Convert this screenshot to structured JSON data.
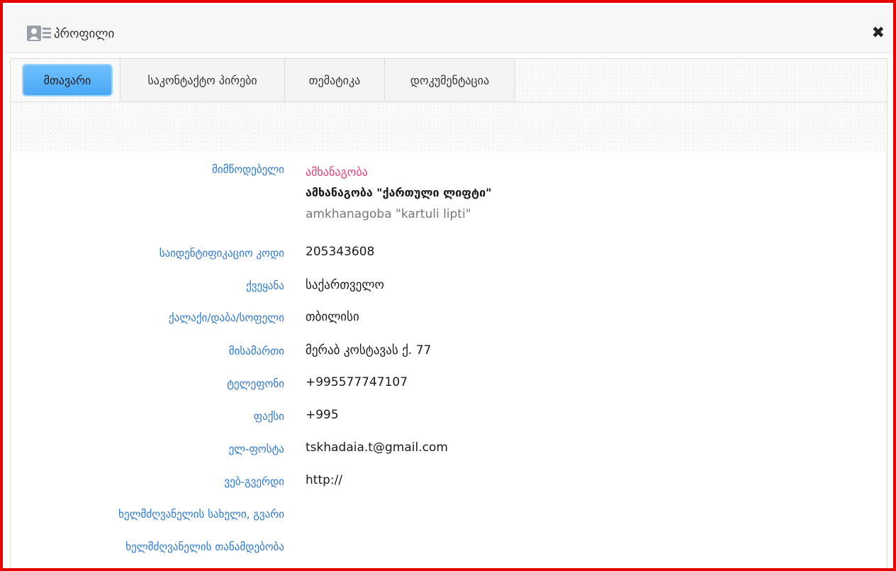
{
  "window": {
    "title": "პროფილი",
    "close_symbol": "✖"
  },
  "tabs": [
    {
      "label": "მთავარი",
      "active": true
    },
    {
      "label": "საკონტაქტო პირები",
      "active": false
    },
    {
      "label": "თემატიკა",
      "active": false
    },
    {
      "label": "დოკუმენტაცია",
      "active": false
    }
  ],
  "fields": {
    "supplier": {
      "label": "მიმწოდებელი",
      "type": "ამხანაგობა",
      "name_ka": "ამხანაგობა \"ქართული ლიფტი\"",
      "name_en": "amkhanagoba \"kartuli lipti\""
    },
    "id_code": {
      "label": "საიდენტიფიკაციო კოდი",
      "value": "205343608"
    },
    "country": {
      "label": "ქვეყანა",
      "value": "საქართველო"
    },
    "city": {
      "label": "ქალაქი/დაბა/სოფელი",
      "value": "თბილისი"
    },
    "address": {
      "label": "მისამართი",
      "value": "მერაბ კოსტავას ქ. 77"
    },
    "phone": {
      "label": "ტელეფონი",
      "value": "+995577747107"
    },
    "fax": {
      "label": "ფაქსი",
      "value": "+995"
    },
    "email": {
      "label": "ელ-ფოსტა",
      "value": "tskhadaia.t@gmail.com"
    },
    "website": {
      "label": "ვებ-გვერდი",
      "value": "http://"
    },
    "head_name": {
      "label": "ხელმძღვანელის სახელი, გვარი",
      "value": ""
    },
    "head_position": {
      "label": "ხელმძღვანელის თანამდებობა",
      "value": ""
    }
  },
  "colors": {
    "border": "#e60000",
    "accent_tab": "#4aa8f5",
    "label": "#2a78d8",
    "supplier_type": "#e83a7a"
  },
  "icons": [
    "profile-card-icon",
    "close-icon"
  ]
}
